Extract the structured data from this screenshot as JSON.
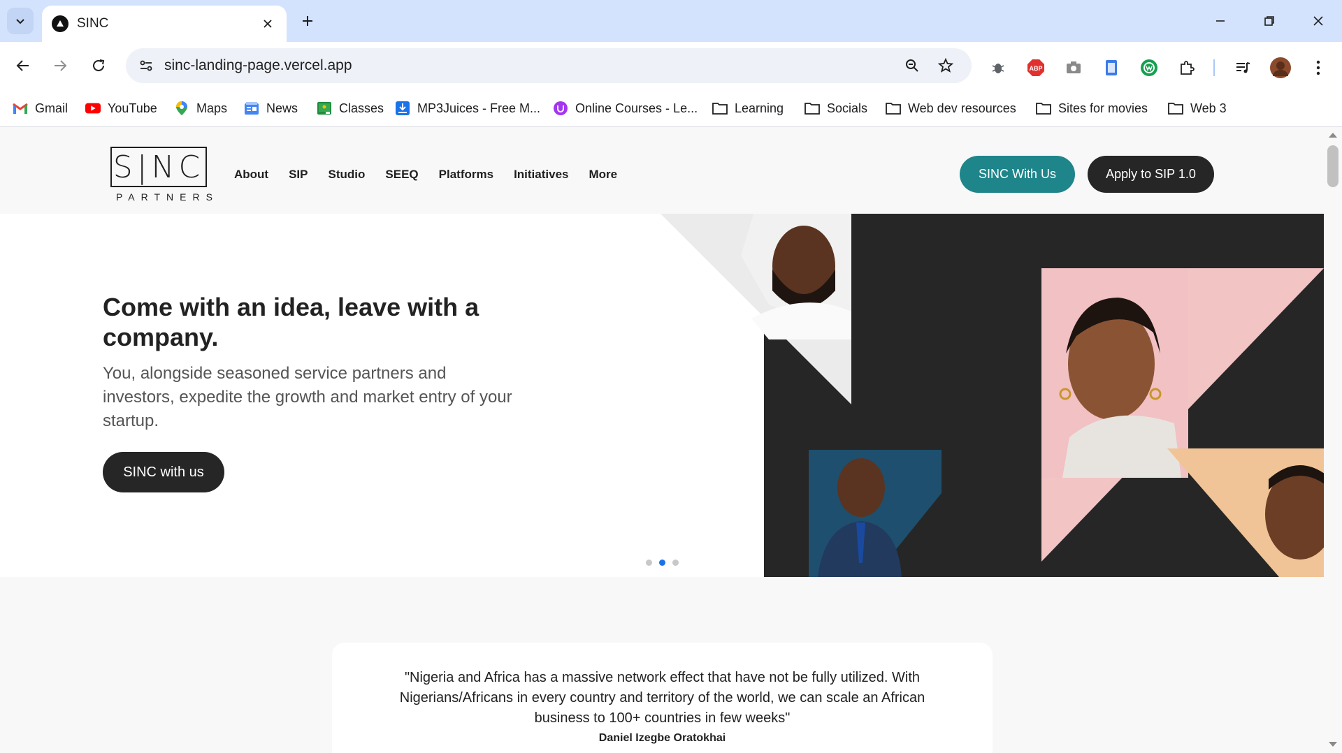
{
  "browser": {
    "tab_title": "SINC",
    "url": "sinc-landing-page.vercel.app",
    "bookmarks": [
      {
        "label": "Gmail",
        "icon": "gmail-icon"
      },
      {
        "label": "YouTube",
        "icon": "youtube-icon"
      },
      {
        "label": "Maps",
        "icon": "maps-icon"
      },
      {
        "label": "News",
        "icon": "news-icon"
      },
      {
        "label": "Classes",
        "icon": "classes-icon"
      },
      {
        "label": "MP3Juices - Free M...",
        "icon": "download-icon"
      },
      {
        "label": "Online Courses - Le...",
        "icon": "udemy-icon"
      },
      {
        "label": "Learning",
        "icon": "folder-icon"
      },
      {
        "label": "Socials",
        "icon": "folder-icon"
      },
      {
        "label": "Web dev resources",
        "icon": "folder-icon"
      },
      {
        "label": "Sites for movies",
        "icon": "folder-icon"
      },
      {
        "label": "Web 3",
        "icon": "folder-icon"
      }
    ]
  },
  "site": {
    "logo_text": "S|NC",
    "logo_sub": "PARTNERS",
    "nav": [
      "About",
      "SIP",
      "Studio",
      "SEEQ",
      "Platforms",
      "Initiatives",
      "More"
    ],
    "btn_sinc": "SINC With Us",
    "btn_apply": "Apply to SIP 1.0",
    "accent": "#1e858a",
    "dark": "#262626"
  },
  "hero": {
    "title": "Come with an idea, leave with a company.",
    "subtitle": "You, alongside seasoned service partners and investors, expedite the growth and market entry of your startup.",
    "cta": "SINC with us",
    "slide_count": 3,
    "active_slide": 2
  },
  "testimonial": {
    "quote": "\"Nigeria and Africa has a massive network effect that have not be fully utilized. With Nigerians/Africans in every country and territory of the world, we can scale an African business to 100+ countries in few weeks\"",
    "author": "Daniel Izegbe Oratokhai"
  }
}
